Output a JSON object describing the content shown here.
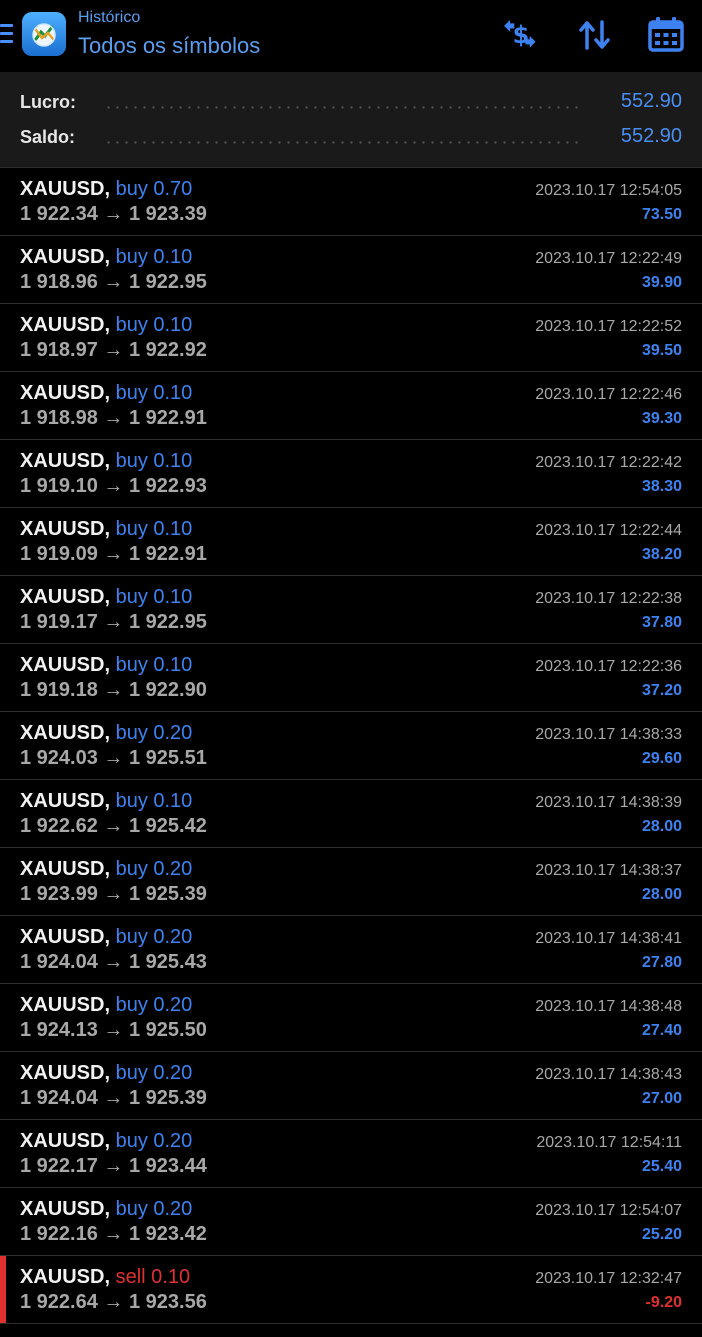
{
  "header": {
    "subtitle": "Histórico",
    "title": "Todos os símbolos",
    "menu_icon": "hamburger-menu-icon",
    "logo_icon": "metatrader-logo-icon",
    "buttons": [
      {
        "name": "currency-swap-icon"
      },
      {
        "name": "sort-arrows-icon"
      },
      {
        "name": "calendar-icon"
      }
    ],
    "accent_color": "#4a8ef0"
  },
  "summary": {
    "profit_label": "Lucro:",
    "profit_value": "552.90",
    "balance_label": "Saldo:",
    "balance_value": "552.90"
  },
  "colors": {
    "buy": "#3d82f0",
    "sell": "#e03030",
    "profit_positive": "#3d82f0",
    "profit_negative": "#e03030"
  },
  "deals": [
    {
      "symbol": "XAUUSD",
      "type": "buy 0.70",
      "side": "buy",
      "prices": "1 922.34 → 1 923.39",
      "time": "2023.10.17 12:54:05",
      "profit": "73.50"
    },
    {
      "symbol": "XAUUSD",
      "type": "buy 0.10",
      "side": "buy",
      "prices": "1 918.96 → 1 922.95",
      "time": "2023.10.17 12:22:49",
      "profit": "39.90"
    },
    {
      "symbol": "XAUUSD",
      "type": "buy 0.10",
      "side": "buy",
      "prices": "1 918.97 → 1 922.92",
      "time": "2023.10.17 12:22:52",
      "profit": "39.50"
    },
    {
      "symbol": "XAUUSD",
      "type": "buy 0.10",
      "side": "buy",
      "prices": "1 918.98 → 1 922.91",
      "time": "2023.10.17 12:22:46",
      "profit": "39.30"
    },
    {
      "symbol": "XAUUSD",
      "type": "buy 0.10",
      "side": "buy",
      "prices": "1 919.10 → 1 922.93",
      "time": "2023.10.17 12:22:42",
      "profit": "38.30"
    },
    {
      "symbol": "XAUUSD",
      "type": "buy 0.10",
      "side": "buy",
      "prices": "1 919.09 → 1 922.91",
      "time": "2023.10.17 12:22:44",
      "profit": "38.20"
    },
    {
      "symbol": "XAUUSD",
      "type": "buy 0.10",
      "side": "buy",
      "prices": "1 919.17 → 1 922.95",
      "time": "2023.10.17 12:22:38",
      "profit": "37.80"
    },
    {
      "symbol": "XAUUSD",
      "type": "buy 0.10",
      "side": "buy",
      "prices": "1 919.18 → 1 922.90",
      "time": "2023.10.17 12:22:36",
      "profit": "37.20"
    },
    {
      "symbol": "XAUUSD",
      "type": "buy 0.20",
      "side": "buy",
      "prices": "1 924.03 → 1 925.51",
      "time": "2023.10.17 14:38:33",
      "profit": "29.60"
    },
    {
      "symbol": "XAUUSD",
      "type": "buy 0.10",
      "side": "buy",
      "prices": "1 922.62 → 1 925.42",
      "time": "2023.10.17 14:38:39",
      "profit": "28.00"
    },
    {
      "symbol": "XAUUSD",
      "type": "buy 0.20",
      "side": "buy",
      "prices": "1 923.99 → 1 925.39",
      "time": "2023.10.17 14:38:37",
      "profit": "28.00"
    },
    {
      "symbol": "XAUUSD",
      "type": "buy 0.20",
      "side": "buy",
      "prices": "1 924.04 → 1 925.43",
      "time": "2023.10.17 14:38:41",
      "profit": "27.80"
    },
    {
      "symbol": "XAUUSD",
      "type": "buy 0.20",
      "side": "buy",
      "prices": "1 924.13 → 1 925.50",
      "time": "2023.10.17 14:38:48",
      "profit": "27.40"
    },
    {
      "symbol": "XAUUSD",
      "type": "buy 0.20",
      "side": "buy",
      "prices": "1 924.04 → 1 925.39",
      "time": "2023.10.17 14:38:43",
      "profit": "27.00"
    },
    {
      "symbol": "XAUUSD",
      "type": "buy 0.20",
      "side": "buy",
      "prices": "1 922.17 → 1 923.44",
      "time": "2023.10.17 12:54:11",
      "profit": "25.40"
    },
    {
      "symbol": "XAUUSD",
      "type": "buy 0.20",
      "side": "buy",
      "prices": "1 922.16 → 1 923.42",
      "time": "2023.10.17 12:54:07",
      "profit": "25.20"
    },
    {
      "symbol": "XAUUSD",
      "type": "sell 0.10",
      "side": "sell",
      "prices": "1 922.64 → 1 923.56",
      "time": "2023.10.17 12:32:47",
      "profit": "-9.20"
    }
  ]
}
